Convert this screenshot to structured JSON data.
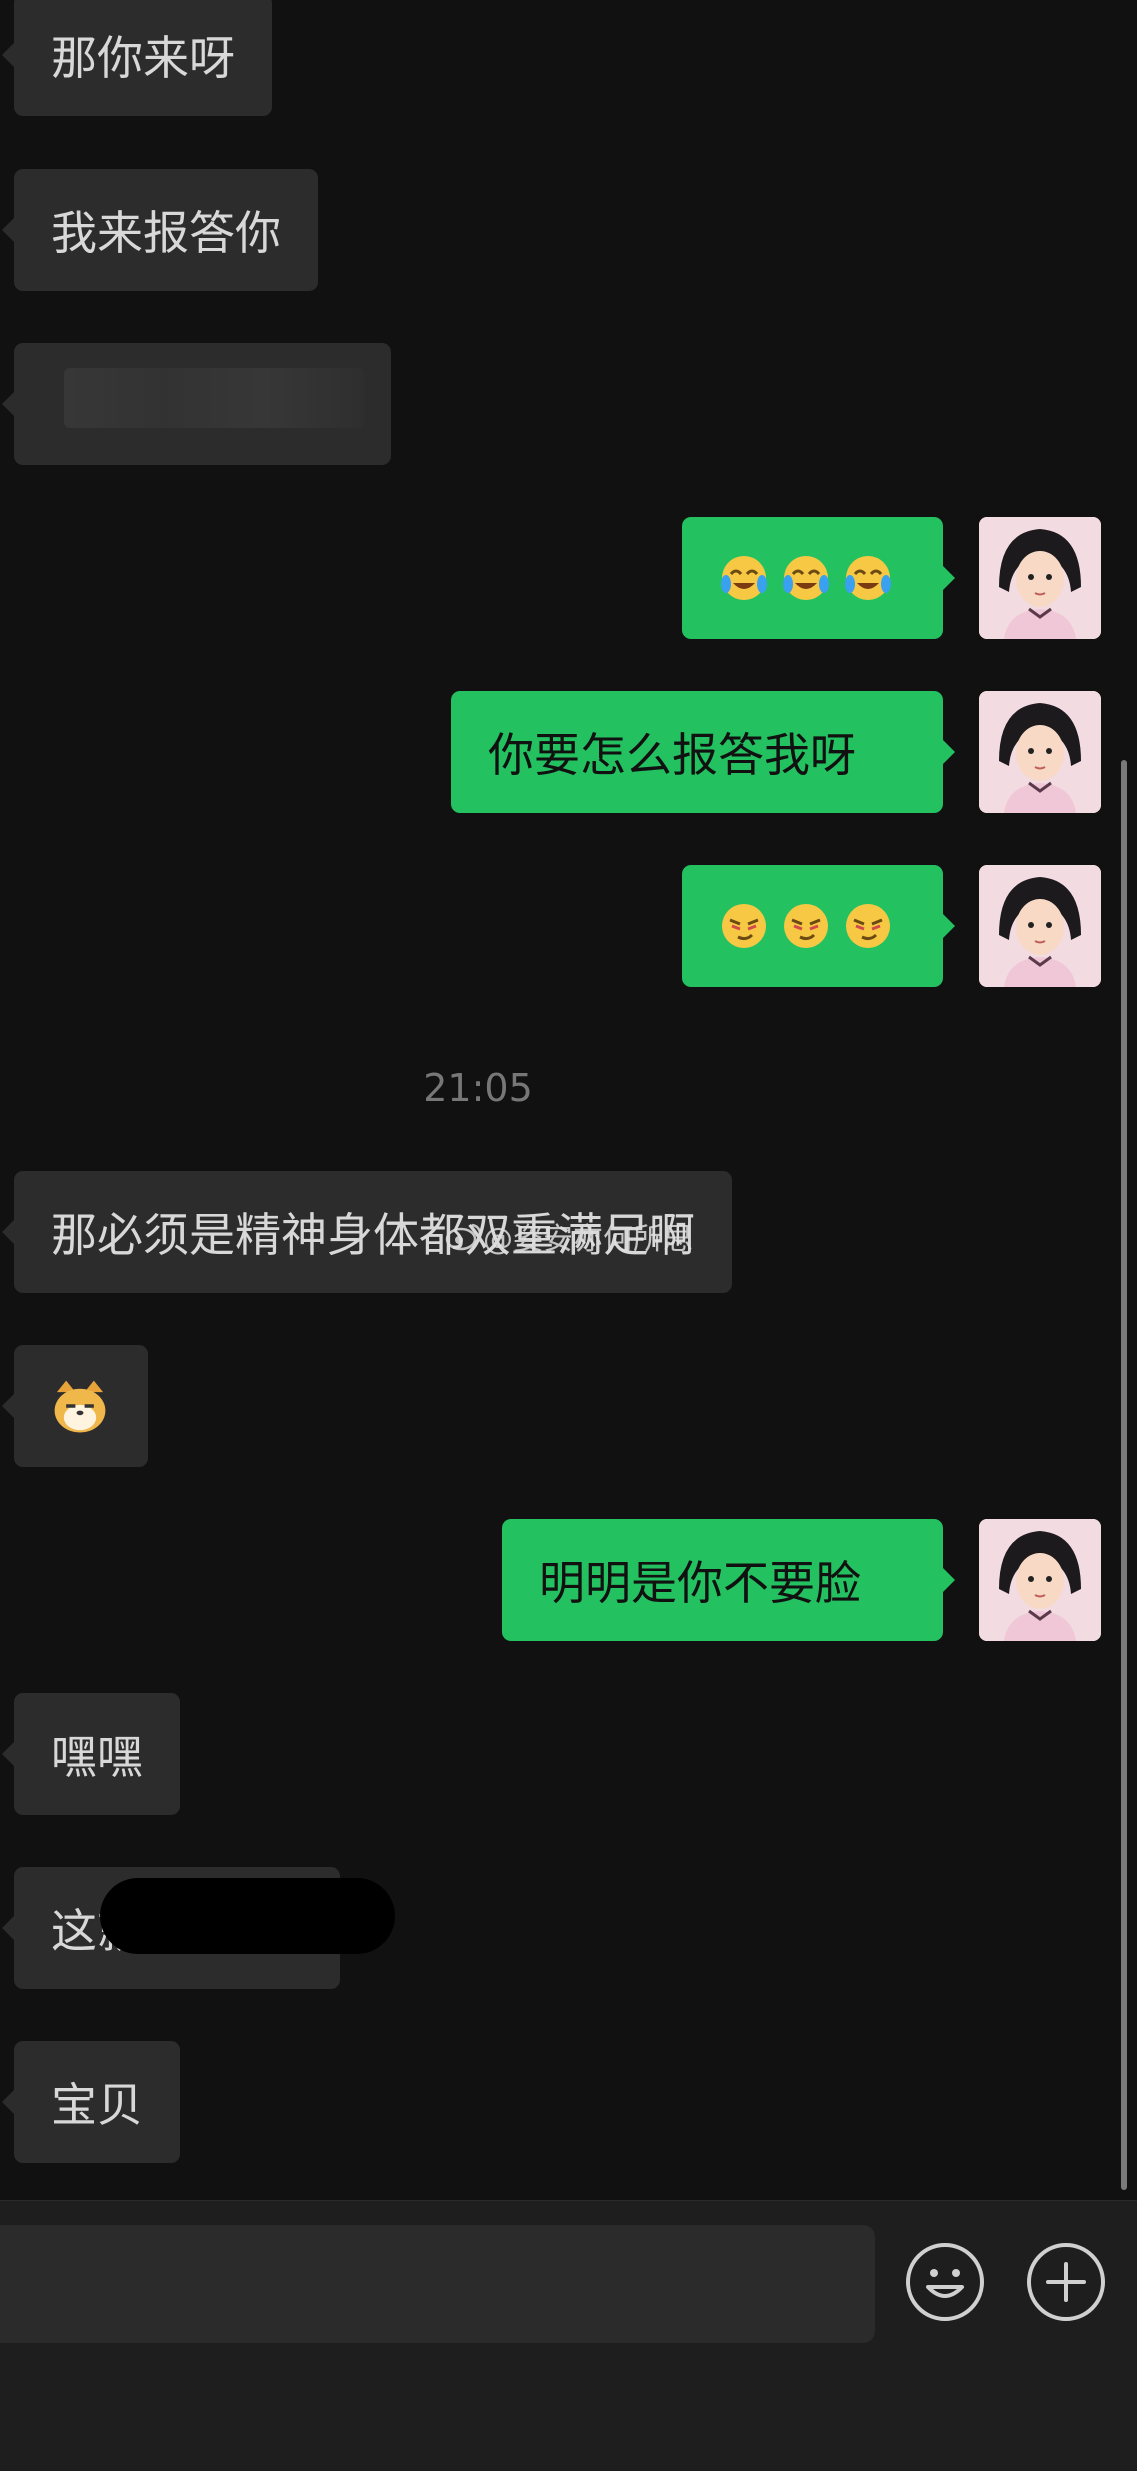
{
  "messages": {
    "m1": "那你来呀",
    "m2": "我来报答你",
    "m5": "你要怎么报答我呀",
    "timestamp": "21:05",
    "m7": "那必须是精神身体都双重满足啊",
    "m9": "明明是你不要脸",
    "m10": "嘿嘿",
    "m11": "这就是",
    "m12": "宝贝"
  },
  "emoji": {
    "m4": [
      "tears-of-joy-face",
      "tears-of-joy-face",
      "tears-of-joy-face"
    ],
    "m6": [
      "smirk-face",
      "smirk-face",
      "smirk-face"
    ],
    "m8": "doge-cat-face"
  },
  "watermark": "@姿安亦何所思",
  "colors": {
    "background": "#111111",
    "incoming_bubble": "#2c2c2c",
    "outgoing_bubble": "#23c160"
  },
  "icons": {
    "emoji_button": "smiley-icon",
    "more_button": "plus-circle-icon"
  }
}
